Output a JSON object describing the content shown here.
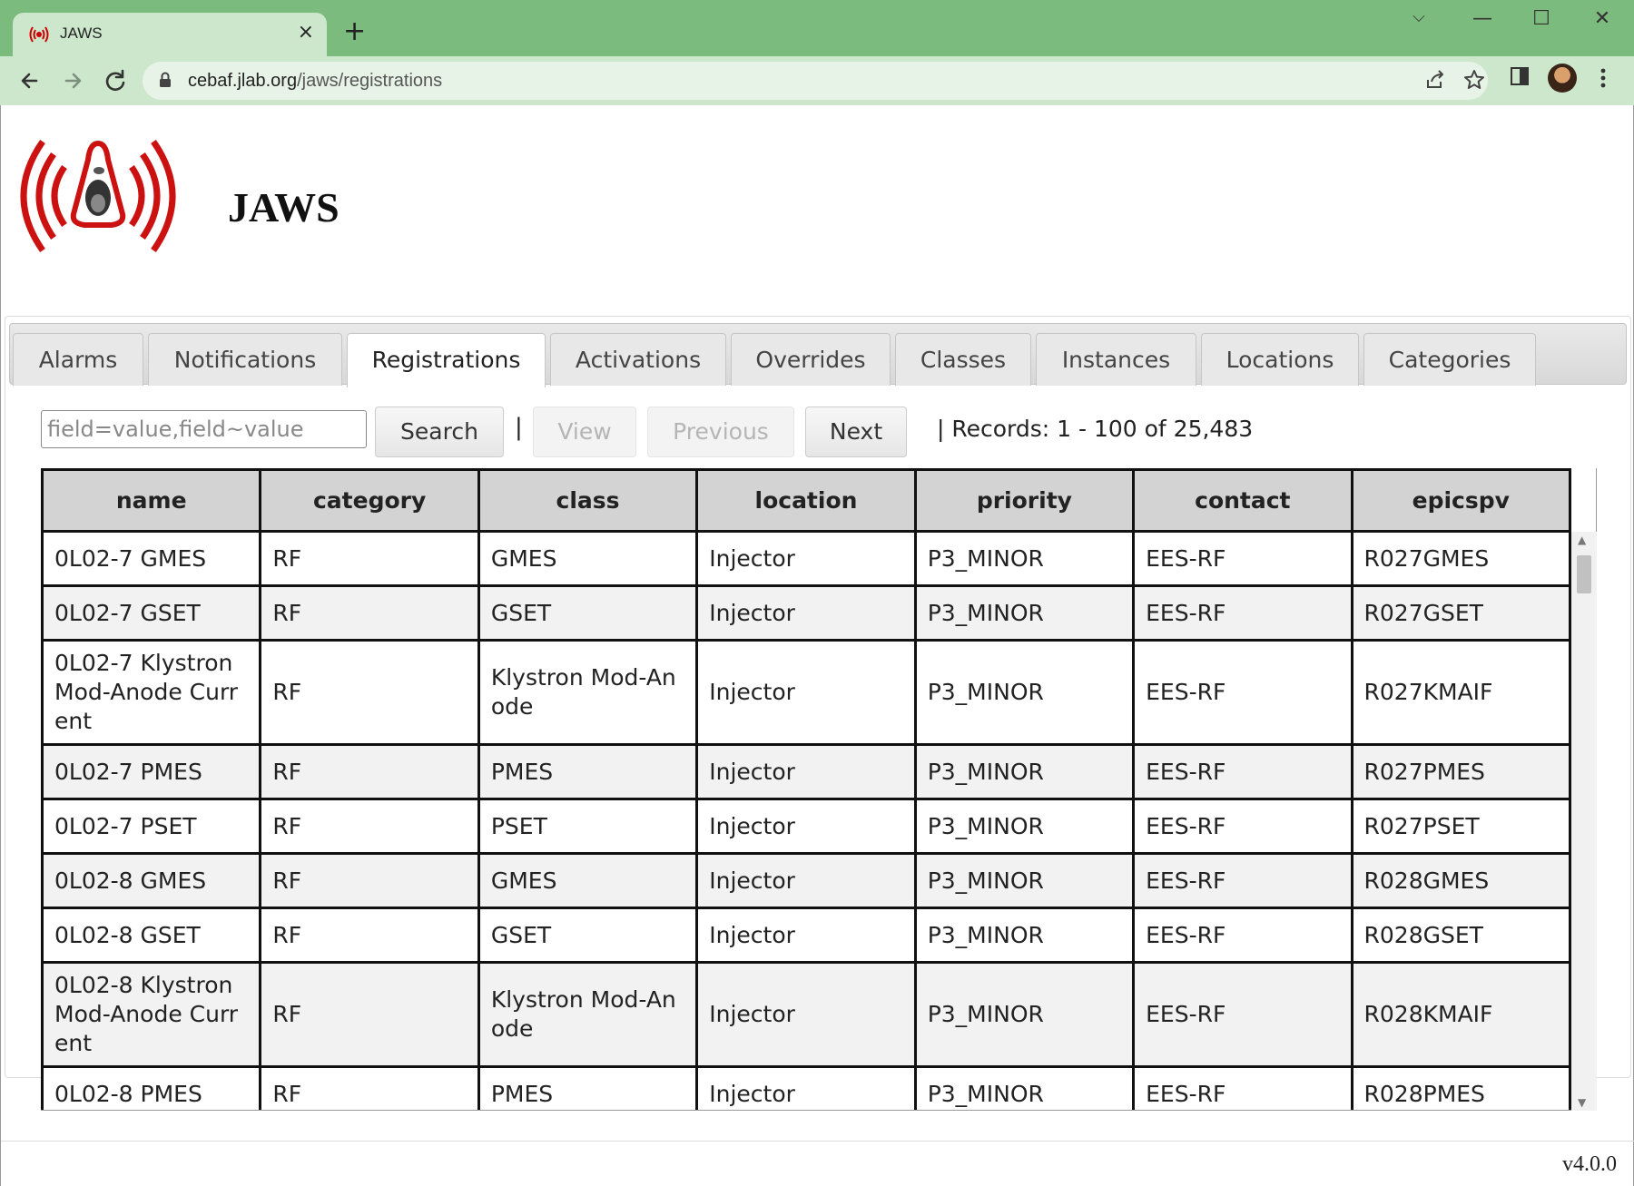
{
  "browser": {
    "tab_title": "JAWS",
    "tab_close": "×",
    "new_tab": "+",
    "url_host": "cebaf.jlab.org",
    "url_path": "/jaws/registrations",
    "win_minimize": "⌵",
    "win_min": "—",
    "win_max": "☐",
    "win_close": "✕",
    "icons": [
      "back-icon",
      "forward-icon",
      "reload-icon",
      "lock-icon",
      "share-icon",
      "star-icon",
      "side-panel-icon",
      "profile-avatar",
      "menu-icon"
    ]
  },
  "header": {
    "app_title": "JAWS"
  },
  "nav_tabs": [
    {
      "label": "Alarms",
      "active": false
    },
    {
      "label": "Notifications",
      "active": false
    },
    {
      "label": "Registrations",
      "active": true
    },
    {
      "label": "Activations",
      "active": false
    },
    {
      "label": "Overrides",
      "active": false
    },
    {
      "label": "Classes",
      "active": false
    },
    {
      "label": "Instances",
      "active": false
    },
    {
      "label": "Locations",
      "active": false
    },
    {
      "label": "Categories",
      "active": false
    }
  ],
  "filter": {
    "placeholder": "field=value,field~value",
    "search_label": "Search",
    "separator": "|",
    "view_label": "View",
    "previous_label": "Previous",
    "next_label": "Next",
    "records_text": "| Records: 1 - 100 of 25,483"
  },
  "table": {
    "columns": [
      "name",
      "category",
      "class",
      "location",
      "priority",
      "contact",
      "epicspv"
    ],
    "rows": [
      [
        "0L02-7 GMES",
        "RF",
        "GMES",
        "Injector",
        "P3_MINOR",
        "EES-RF",
        "R027GMES"
      ],
      [
        "0L02-7 GSET",
        "RF",
        "GSET",
        "Injector",
        "P3_MINOR",
        "EES-RF",
        "R027GSET"
      ],
      [
        "0L02-7 Klystron Mod-Anode Current",
        "RF",
        "Klystron Mod-Anode",
        "Injector",
        "P3_MINOR",
        "EES-RF",
        "R027KMAIF"
      ],
      [
        "0L02-7 PMES",
        "RF",
        "PMES",
        "Injector",
        "P3_MINOR",
        "EES-RF",
        "R027PMES"
      ],
      [
        "0L02-7 PSET",
        "RF",
        "PSET",
        "Injector",
        "P3_MINOR",
        "EES-RF",
        "R027PSET"
      ],
      [
        "0L02-8 GMES",
        "RF",
        "GMES",
        "Injector",
        "P3_MINOR",
        "EES-RF",
        "R028GMES"
      ],
      [
        "0L02-8 GSET",
        "RF",
        "GSET",
        "Injector",
        "P3_MINOR",
        "EES-RF",
        "R028GSET"
      ],
      [
        "0L02-8 Klystron Mod-Anode Current",
        "RF",
        "Klystron Mod-Anode",
        "Injector",
        "P3_MINOR",
        "EES-RF",
        "R028KMAIF"
      ],
      [
        "0L02-8 PMES",
        "RF",
        "PMES",
        "Injector",
        "P3_MINOR",
        "EES-RF",
        "R028PMES"
      ]
    ]
  },
  "footer": {
    "version": "v4.0.0"
  }
}
